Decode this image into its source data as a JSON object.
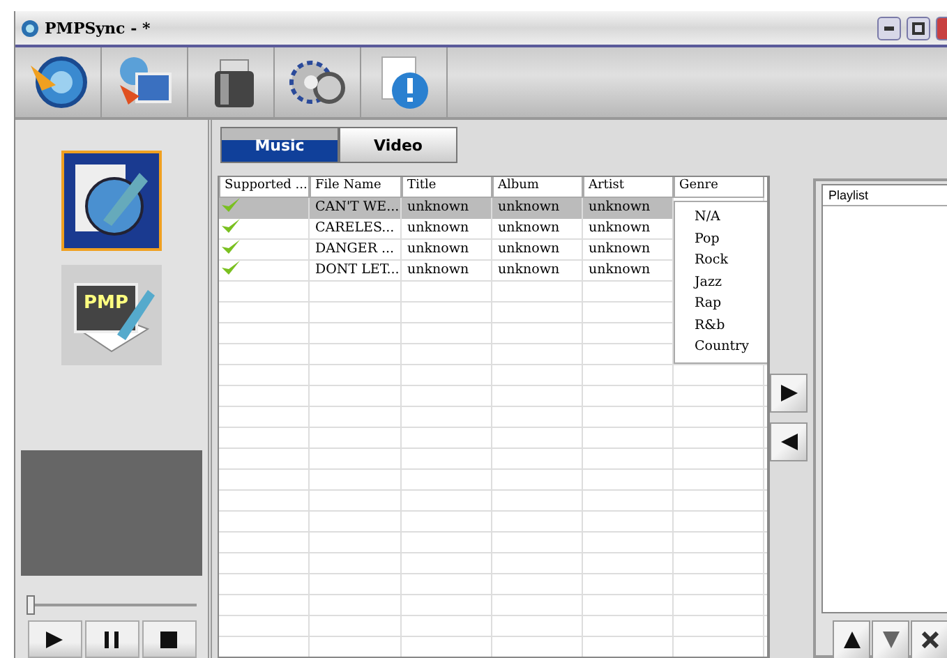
{
  "window": {
    "title": "PMPSync - *"
  },
  "toolbar": {
    "tools": [
      {
        "kind": "sync"
      },
      {
        "kind": "transfer"
      },
      {
        "kind": "trash"
      },
      {
        "kind": "settings"
      },
      {
        "kind": "info"
      }
    ]
  },
  "sidebar": {
    "modes": [
      {
        "kind": "edit",
        "selected": true
      },
      {
        "kind": "pmp",
        "selected": false
      }
    ],
    "label": "PMP",
    "seek": {
      "level": 0.0
    },
    "controls": [
      {
        "kind": "play"
      },
      {
        "kind": "pause"
      },
      {
        "kind": "stop"
      }
    ]
  },
  "tabs": [
    {
      "label": "Music",
      "selected": true
    },
    {
      "label": "Video",
      "selected": false
    }
  ],
  "table": {
    "columns": [
      "Supported ...",
      "File Name",
      "Title",
      "Album",
      "Artist",
      "Genre"
    ],
    "rows": [
      {
        "supported": true,
        "selected": true,
        "cells": [
          "",
          "CAN'T WE...",
          "unknown",
          "unknown",
          "unknown"
        ]
      },
      {
        "supported": true,
        "selected": false,
        "cells": [
          "",
          "CARELES...",
          "unknown",
          "unknown",
          "unknown"
        ]
      },
      {
        "supported": true,
        "selected": false,
        "cells": [
          "",
          "DANGER ...",
          "unknown",
          "unknown",
          "unknown"
        ]
      },
      {
        "supported": true,
        "selected": false,
        "cells": [
          "",
          "DONT LET...",
          "unknown",
          "unknown",
          "unknown"
        ]
      }
    ]
  },
  "genre_menu": [
    "N/A",
    "Pop",
    "Rock",
    "Jazz",
    "Rap",
    "R&b",
    "Country"
  ],
  "transfer": [
    {
      "kind": "add"
    },
    {
      "kind": "remove"
    }
  ],
  "playlist": {
    "header": "Playlist",
    "controls": [
      {
        "kind": "up"
      },
      {
        "kind": "down"
      },
      {
        "kind": "delete"
      }
    ]
  }
}
